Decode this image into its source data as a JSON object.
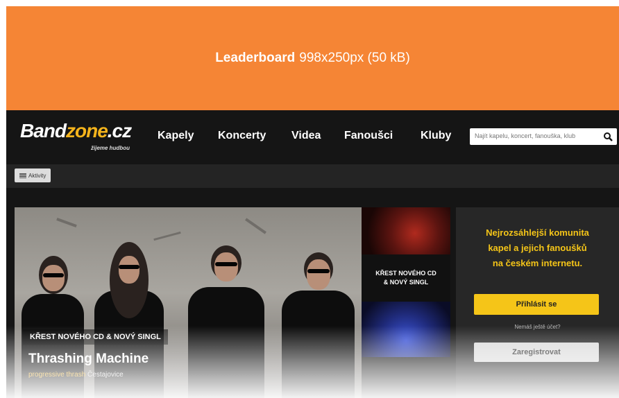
{
  "banner": {
    "title": "Leaderboard",
    "spec": "998x250px (50 kB)",
    "color": "#f58535"
  },
  "logo": {
    "part1": "Band",
    "part2": "zone",
    "part3": ".cz",
    "tagline": "žijeme hudbou"
  },
  "nav": {
    "items": [
      "Kapely",
      "Koncerty",
      "Videa",
      "Fanoušci",
      "Kluby"
    ]
  },
  "search": {
    "placeholder": "Najít kapelu, koncert, fanouška, klub",
    "icon": "search-icon"
  },
  "subbar": {
    "activity_label": "Aktivity"
  },
  "hero": {
    "caption": "KŘEST NOVÉHO CD & NOVÝ SINGL",
    "band_name": "Thrashing Machine",
    "genre": "progressive thrash",
    "location": "Čestajovice"
  },
  "thumbnails": {
    "item2_line1": "KŘEST NOVÉHO CD",
    "item2_line2": "& NOVÝ SINGL"
  },
  "panel": {
    "headline_line1": "Nejrozsáhlejší komunita",
    "headline_line2": "kapel a jejich fanoušků",
    "headline_line3": "na českém internetu.",
    "login_label": "Přihlásit se",
    "no_account": "Nemáš ještě účet?",
    "register_label": "Zaregistrovat",
    "accent": "#f5c518"
  }
}
